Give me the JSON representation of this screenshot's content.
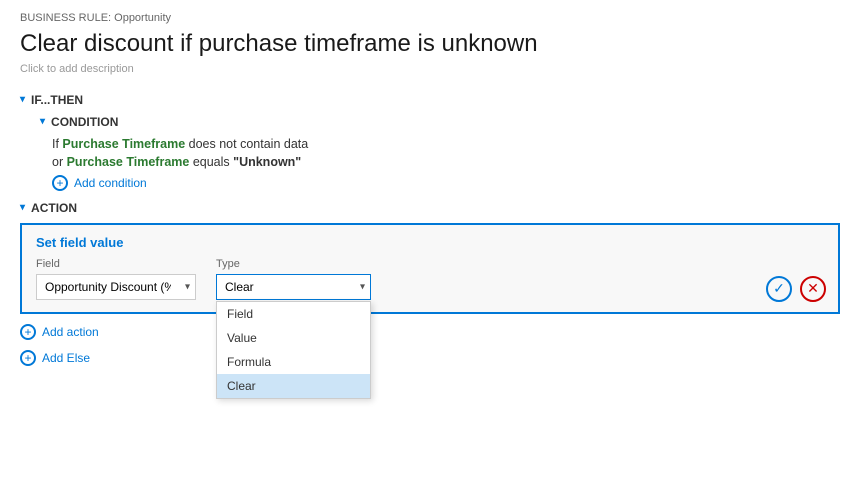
{
  "breadcrumb": {
    "text": "BUSINESS RULE: Opportunity"
  },
  "page": {
    "title": "Clear discount if purchase timeframe is unknown",
    "description_hint": "Click to add description"
  },
  "sections": {
    "if_then": {
      "label": "IF...THEN",
      "chevron": "▾"
    },
    "condition": {
      "label": "CONDITION",
      "chevron": "▾",
      "lines": [
        {
          "prefix": "If",
          "field": "Purchase Timeframe",
          "condition": "does not contain data",
          "value": ""
        },
        {
          "prefix": "or",
          "field": "Purchase Timeframe",
          "condition": "equals",
          "value": "\"Unknown\""
        }
      ],
      "add_label": "Add condition"
    },
    "action": {
      "label": "ACTION",
      "chevron": "▾",
      "card": {
        "title": "Set field value",
        "field_label": "Field",
        "field_value": "Opportunity Discount (%)",
        "type_label": "Type",
        "type_value": "Clear",
        "dropdown_items": [
          {
            "label": "Field",
            "selected": false
          },
          {
            "label": "Value",
            "selected": false
          },
          {
            "label": "Formula",
            "selected": false
          },
          {
            "label": "Clear",
            "selected": true
          }
        ]
      },
      "add_action_label": "Add action"
    },
    "add_else": {
      "label": "Add Else"
    }
  },
  "icons": {
    "check": "✓",
    "close": "✕",
    "chevron_down": "▾",
    "plus": "+"
  }
}
